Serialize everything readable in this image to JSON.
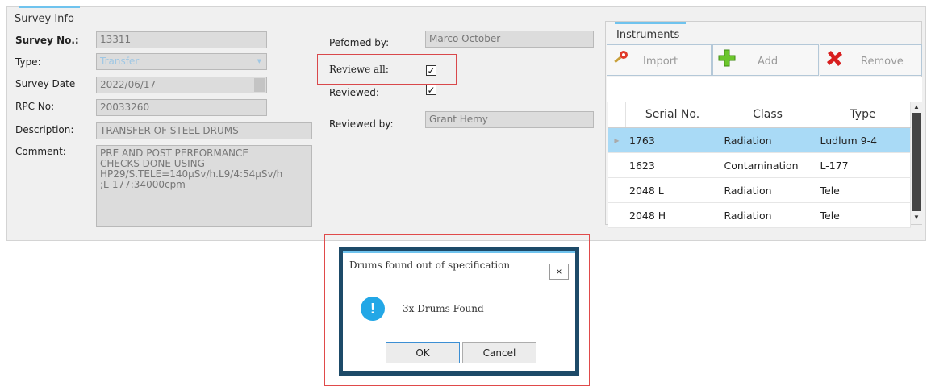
{
  "survey": {
    "tab_title": "Survey Info",
    "survey_no_label": "Survey No.:",
    "survey_no_value": "13311",
    "type_label": "Type:",
    "type_value": "Transfer",
    "survey_date_label": "Survey Date",
    "survey_date_value": "2022/06/17",
    "rpc_label": "RPC No:",
    "rpc_value": "20033260",
    "description_label": "Description:",
    "description_value": "TRANSFER OF STEEL DRUMS",
    "comment_label": "Comment:",
    "comment_value": "PRE AND POST PERFORMANCE\nCHECKS DONE USING\nHP29/S.TELE=140µSv/h.L9/4:54µSv/h\n;L-177:34000cpm",
    "performed_by_label": "Pefomed by:",
    "performed_by_value": "Marco October",
    "review_all_label": "Reviewe all:",
    "review_all_checked": true,
    "reviewed_label": "Reviewed:",
    "reviewed_checked": true,
    "reviewed_by_label": "Reviewed by:",
    "reviewed_by_value": "Grant Hemy"
  },
  "instruments": {
    "title": "Instruments",
    "toolbar": {
      "import_label": "Import",
      "add_label": "Add",
      "remove_label": "Remove"
    },
    "columns": [
      "Serial No.",
      "Class",
      "Type"
    ],
    "rows": [
      {
        "serial": "1763",
        "class": "Radiation",
        "type": "Ludlum 9-4",
        "selected": true
      },
      {
        "serial": "1623",
        "class": "Contamination",
        "type": "L-177",
        "selected": false
      },
      {
        "serial": "2048 L",
        "class": "Radiation",
        "type": "Tele",
        "selected": false
      },
      {
        "serial": "2048 H",
        "class": "Radiation",
        "type": "Tele",
        "selected": false
      }
    ]
  },
  "dialog": {
    "title": "Drums found out of specification",
    "close_label": "×",
    "message": "3x Drums Found",
    "icon_glyph": "!",
    "ok_label": "OK",
    "cancel_label": "Cancel"
  },
  "colors": {
    "accent": "#6fc3ee",
    "selected_row": "#a9daf6",
    "highlight_box": "#d9484b",
    "dialog_border": "#1d4a68",
    "info_icon": "#23a7e6"
  }
}
